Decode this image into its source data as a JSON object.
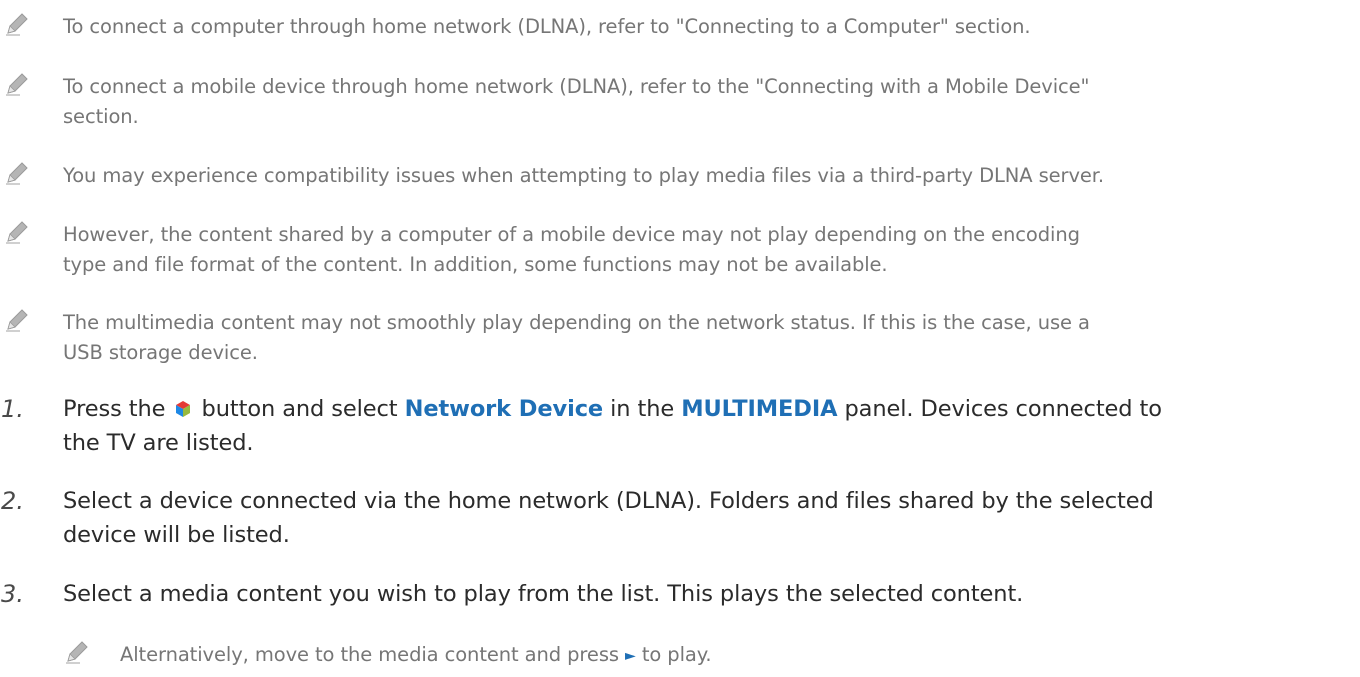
{
  "notes": [
    {
      "icon": "pencil-icon",
      "text": "To connect a computer through home network (DLNA), refer to \"Connecting to a Computer\" section."
    },
    {
      "icon": "pencil-icon",
      "line1": "To connect a mobile device through home network (DLNA), refer to the \"Connecting with a Mobile Device\"",
      "line2": "section."
    },
    {
      "icon": "pencil-icon",
      "text": "You may experience compatibility issues when attempting to play media files via a third-party DLNA server."
    },
    {
      "icon": "pencil-icon",
      "line1": "However, the content shared by a computer of a mobile device may not play depending on the encoding",
      "line2": "type and file format of the content. In addition, some functions may not be available."
    },
    {
      "icon": "pencil-icon",
      "line1": "The multimedia content may not smoothly play depending on the network status. If this is the case, use a",
      "line2": "USB storage device."
    }
  ],
  "steps": [
    {
      "num": "1.",
      "pre": "Press the",
      "icon": "smart-hub-icon",
      "mid1": "button and select",
      "hl1": "Network Device",
      "mid2": "in the",
      "hl2": "MULTIMEDIA",
      "post": "panel. Devices connected to",
      "line2": "the TV are listed."
    },
    {
      "num": "2.",
      "line1": "Select a device connected via the home network (DLNA). Folders and files shared by the selected",
      "line2": "device will be listed."
    },
    {
      "num": "3.",
      "text": "Select a media content you wish to play from the list. This plays the selected content."
    }
  ],
  "subnote": {
    "icon": "pencil-icon",
    "pre": "Alternatively, move to the media content and press",
    "play_icon": "play-icon",
    "post": "to play."
  },
  "colors": {
    "note_text": "#767676",
    "step_text": "#2b2b2b",
    "highlight": "#1f6fb5"
  }
}
